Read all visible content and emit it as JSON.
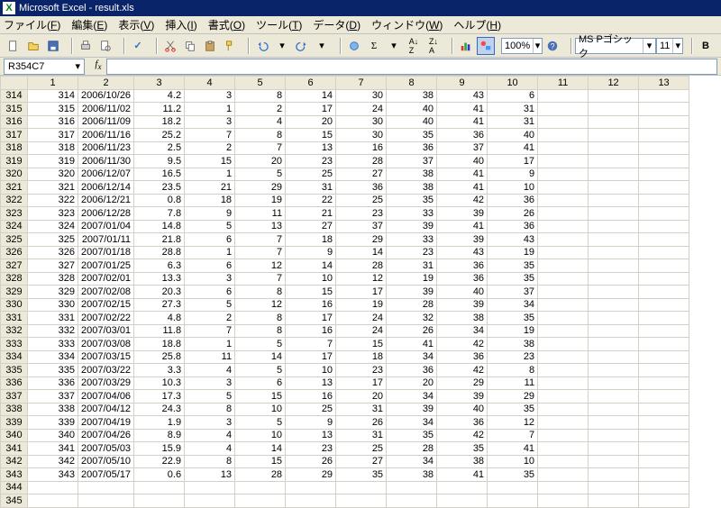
{
  "title": "Microsoft Excel - result.xls",
  "menus": [
    "ファイル(F)",
    "編集(E)",
    "表示(V)",
    "挿入(I)",
    "書式(O)",
    "ツール(T)",
    "データ(D)",
    "ウィンドウ(W)",
    "ヘルプ(H)"
  ],
  "zoom": "100%",
  "font": "MS Pゴシック",
  "fontsize": "11",
  "namebox": "R354C7",
  "col_headers": [
    "1",
    "2",
    "3",
    "4",
    "5",
    "6",
    "7",
    "8",
    "9",
    "10",
    "11",
    "12",
    "13"
  ],
  "row_headers": [
    "314",
    "315",
    "316",
    "317",
    "318",
    "319",
    "320",
    "321",
    "322",
    "323",
    "324",
    "325",
    "326",
    "327",
    "328",
    "329",
    "330",
    "331",
    "332",
    "333",
    "334",
    "335",
    "336",
    "337",
    "338",
    "339",
    "340",
    "341",
    "342",
    "343",
    "344",
    "345"
  ],
  "chart_data": {
    "type": "table",
    "columns": [
      "1",
      "2",
      "3",
      "4",
      "5",
      "6",
      "7",
      "8",
      "9",
      "10"
    ],
    "rows": [
      [
        "314",
        "2006/10/26",
        "4.2",
        "3",
        "8",
        "14",
        "30",
        "38",
        "43",
        "6"
      ],
      [
        "315",
        "2006/11/02",
        "11.2",
        "1",
        "2",
        "17",
        "24",
        "40",
        "41",
        "31"
      ],
      [
        "316",
        "2006/11/09",
        "18.2",
        "3",
        "4",
        "20",
        "30",
        "40",
        "41",
        "31"
      ],
      [
        "317",
        "2006/11/16",
        "25.2",
        "7",
        "8",
        "15",
        "30",
        "35",
        "36",
        "40"
      ],
      [
        "318",
        "2006/11/23",
        "2.5",
        "2",
        "7",
        "13",
        "16",
        "36",
        "37",
        "41"
      ],
      [
        "319",
        "2006/11/30",
        "9.5",
        "15",
        "20",
        "23",
        "28",
        "37",
        "40",
        "17"
      ],
      [
        "320",
        "2006/12/07",
        "16.5",
        "1",
        "5",
        "25",
        "27",
        "38",
        "41",
        "9"
      ],
      [
        "321",
        "2006/12/14",
        "23.5",
        "21",
        "29",
        "31",
        "36",
        "38",
        "41",
        "10"
      ],
      [
        "322",
        "2006/12/21",
        "0.8",
        "18",
        "19",
        "22",
        "25",
        "35",
        "42",
        "36"
      ],
      [
        "323",
        "2006/12/28",
        "7.8",
        "9",
        "11",
        "21",
        "23",
        "33",
        "39",
        "26"
      ],
      [
        "324",
        "2007/01/04",
        "14.8",
        "5",
        "13",
        "27",
        "37",
        "39",
        "41",
        "36"
      ],
      [
        "325",
        "2007/01/11",
        "21.8",
        "6",
        "7",
        "18",
        "29",
        "33",
        "39",
        "43"
      ],
      [
        "326",
        "2007/01/18",
        "28.8",
        "1",
        "7",
        "9",
        "14",
        "23",
        "43",
        "19"
      ],
      [
        "327",
        "2007/01/25",
        "6.3",
        "6",
        "12",
        "14",
        "28",
        "31",
        "36",
        "35"
      ],
      [
        "328",
        "2007/02/01",
        "13.3",
        "3",
        "7",
        "10",
        "12",
        "19",
        "36",
        "35"
      ],
      [
        "329",
        "2007/02/08",
        "20.3",
        "6",
        "8",
        "15",
        "17",
        "39",
        "40",
        "37"
      ],
      [
        "330",
        "2007/02/15",
        "27.3",
        "5",
        "12",
        "16",
        "19",
        "28",
        "39",
        "34"
      ],
      [
        "331",
        "2007/02/22",
        "4.8",
        "2",
        "8",
        "17",
        "24",
        "32",
        "38",
        "35"
      ],
      [
        "332",
        "2007/03/01",
        "11.8",
        "7",
        "8",
        "16",
        "24",
        "26",
        "34",
        "19"
      ],
      [
        "333",
        "2007/03/08",
        "18.8",
        "1",
        "5",
        "7",
        "15",
        "41",
        "42",
        "38"
      ],
      [
        "334",
        "2007/03/15",
        "25.8",
        "11",
        "14",
        "17",
        "18",
        "34",
        "36",
        "23"
      ],
      [
        "335",
        "2007/03/22",
        "3.3",
        "4",
        "5",
        "10",
        "23",
        "36",
        "42",
        "8"
      ],
      [
        "336",
        "2007/03/29",
        "10.3",
        "3",
        "6",
        "13",
        "17",
        "20",
        "29",
        "11"
      ],
      [
        "337",
        "2007/04/06",
        "17.3",
        "5",
        "15",
        "16",
        "20",
        "34",
        "39",
        "29"
      ],
      [
        "338",
        "2007/04/12",
        "24.3",
        "8",
        "10",
        "25",
        "31",
        "39",
        "40",
        "35"
      ],
      [
        "339",
        "2007/04/19",
        "1.9",
        "3",
        "5",
        "9",
        "26",
        "34",
        "36",
        "12"
      ],
      [
        "340",
        "2007/04/26",
        "8.9",
        "4",
        "10",
        "13",
        "31",
        "35",
        "42",
        "7"
      ],
      [
        "341",
        "2007/05/03",
        "15.9",
        "4",
        "14",
        "23",
        "25",
        "28",
        "35",
        "41"
      ],
      [
        "342",
        "2007/05/10",
        "22.9",
        "8",
        "15",
        "26",
        "27",
        "34",
        "38",
        "10"
      ],
      [
        "343",
        "2007/05/17",
        "0.6",
        "13",
        "28",
        "29",
        "35",
        "38",
        "41",
        "35"
      ],
      [
        "",
        "",
        "",
        "",
        "",
        "",
        "",
        "",
        "",
        ""
      ],
      [
        "",
        "",
        "",
        "",
        "",
        "",
        "",
        "",
        "",
        ""
      ]
    ]
  }
}
